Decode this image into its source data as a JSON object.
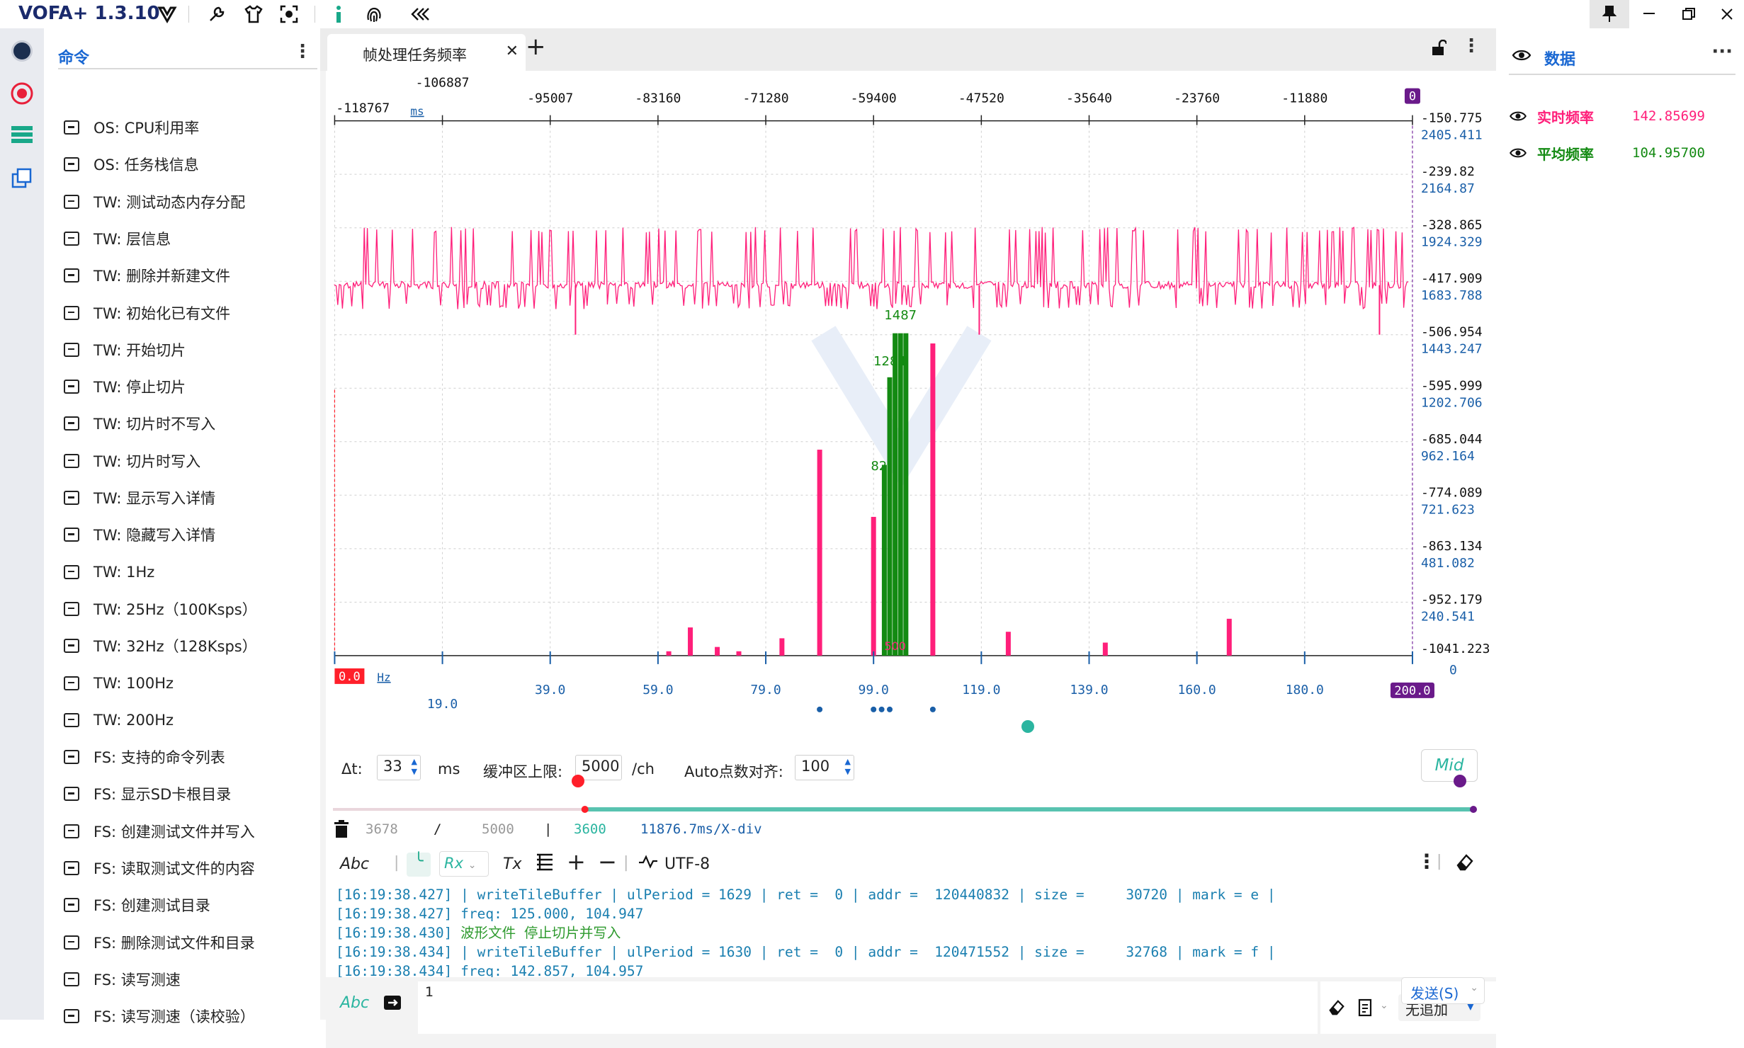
{
  "app": {
    "title": "VOFA+ 1.3.10"
  },
  "colors": {
    "accent": "#1967d2",
    "series_pink": "#ff1f7a",
    "series_green": "#138a12",
    "teal": "#2bb5a0",
    "purple": "#6a1a8a"
  },
  "commands": {
    "title": "命令",
    "items": [
      "OS: CPU利用率",
      "OS: 任务栈信息",
      "TW: 测试动态内存分配",
      "TW: 层信息",
      "TW: 删除并新建文件",
      "TW: 初始化已有文件",
      "TW: 开始切片",
      "TW: 停止切片",
      "TW: 切片时不写入",
      "TW: 切片时写入",
      "TW: 显示写入详情",
      "TW: 隐藏写入详情",
      "TW: 1Hz",
      "TW: 25Hz（100Ksps）",
      "TW: 32Hz（128Ksps）",
      "TW: 100Hz",
      "TW: 200Hz",
      "FS: 支持的命令列表",
      "FS: 显示SD卡根目录",
      "FS: 创建测试文件并写入",
      "FS: 读取测试文件的内容",
      "FS: 创建测试目录",
      "FS: 删除测试文件和目录",
      "FS: 读写测速",
      "FS: 读写测速（读校验）"
    ]
  },
  "tab": {
    "label": "帧处理任务频率"
  },
  "chart_data": [
    {
      "type": "line",
      "title": "",
      "x_unit": "ms",
      "x_ticks": [
        "-118767",
        "-106887",
        "-95007",
        "-83160",
        "-71280",
        "-59400",
        "-47520",
        "-35640",
        "-23760",
        "-11880",
        "0"
      ],
      "y_ticks_left_black": [
        "-150.775",
        "-239.82",
        "-328.865",
        "-417.909",
        "-506.954",
        "-595.999",
        "-685.044",
        "-774.089",
        "-863.134",
        "-952.179",
        "-1041.223"
      ],
      "y_ticks_right_blue": [
        "2405.411",
        "2164.87",
        "1924.329",
        "1683.788",
        "1443.247",
        "1202.706",
        "962.164",
        "721.623",
        "481.082",
        "240.541",
        "0"
      ],
      "series": [
        {
          "name": "实时频率",
          "color": "#ff1f7a",
          "baseline": 142.857,
          "spike_high": 1924,
          "spike_low": 1443
        }
      ]
    },
    {
      "type": "bar",
      "x_unit": "Hz",
      "x_ticks": [
        "0.0",
        "19.0",
        "39.0",
        "59.0",
        "79.0",
        "99.0",
        "119.0",
        "139.0",
        "160.0",
        "180.0",
        "200.0"
      ],
      "data_labels": [
        "1487",
        "1284",
        "82",
        "500"
      ],
      "series": [
        {
          "name": "实时频率",
          "color": "#ff1f7a",
          "bars": [
            {
              "x": 62,
              "v": 20
            },
            {
              "x": 66,
              "v": 130
            },
            {
              "x": 71,
              "v": 40
            },
            {
              "x": 75,
              "v": 20
            },
            {
              "x": 83,
              "v": 80
            },
            {
              "x": 90,
              "v": 950
            },
            {
              "x": 100,
              "v": 640
            },
            {
              "x": 111,
              "v": 1440
            },
            {
              "x": 125,
              "v": 110
            },
            {
              "x": 143,
              "v": 60
            },
            {
              "x": 166,
              "v": 170
            }
          ]
        },
        {
          "name": "平均频率",
          "color": "#138a12",
          "bars": [
            {
              "x": 102,
              "v": 880
            },
            {
              "x": 103,
              "v": 1284
            },
            {
              "x": 104,
              "v": 1487
            },
            {
              "x": 105,
              "v": 1487
            },
            {
              "x": 106,
              "v": 1487
            }
          ]
        }
      ]
    }
  ],
  "controls": {
    "dt_label": "Δt:",
    "dt_value": "33",
    "dt_unit": "ms",
    "buffer_label": "缓冲区上限:",
    "buffer_value": "5000",
    "buffer_unit": "/ch",
    "auto_label": "Auto点数对齐:",
    "auto_value": "100",
    "mid_label": "Mid",
    "slider_left": 0.215,
    "slider_mid": 0.61,
    "slider_right": 1.0,
    "stat_count": "3678",
    "stat_sep": "/",
    "stat_limit": "5000",
    "stat_bar": "|",
    "stat_view": "3600",
    "stat_div": "11876.7ms/X-div"
  },
  "terminal": {
    "abc_label": "Abc",
    "rx_label": "Rx",
    "tx_label": "Tx",
    "encoding": "UTF-8",
    "lines": [
      {
        "ts": "[16:19:38.427]",
        "msg": " | writeTileBuffer | ulPeriod = 1629 | ret =  0 | addr =  120440832 | size =     30720 | mark = e |",
        "kind": "blue"
      },
      {
        "ts": "[16:19:38.427]",
        "msg": " freq: 125.000, 104.947",
        "kind": "blue"
      },
      {
        "ts": "[16:19:38.430]",
        "msg": " 波形文件 停止切片并写入",
        "kind": "green"
      },
      {
        "ts": "[16:19:38.434]",
        "msg": " | writeTileBuffer | ulPeriod = 1630 | ret =  0 | addr =  120471552 | size =     32768 | mark = f |",
        "kind": "blue"
      },
      {
        "ts": "[16:19:38.434]",
        "msg": " freq: 142.857, 104.957",
        "kind": "blue"
      }
    ]
  },
  "send": {
    "abc_label": "Abc",
    "input_value": "1",
    "append_mode": "无追加",
    "send_label": "发送(S)"
  },
  "data_panel": {
    "title": "数据",
    "rows": [
      {
        "name": "实时频率",
        "value": "142.85699",
        "color": "#ff1f7a"
      },
      {
        "name": "平均频率",
        "value": "104.95700",
        "color": "#138a12"
      }
    ]
  }
}
